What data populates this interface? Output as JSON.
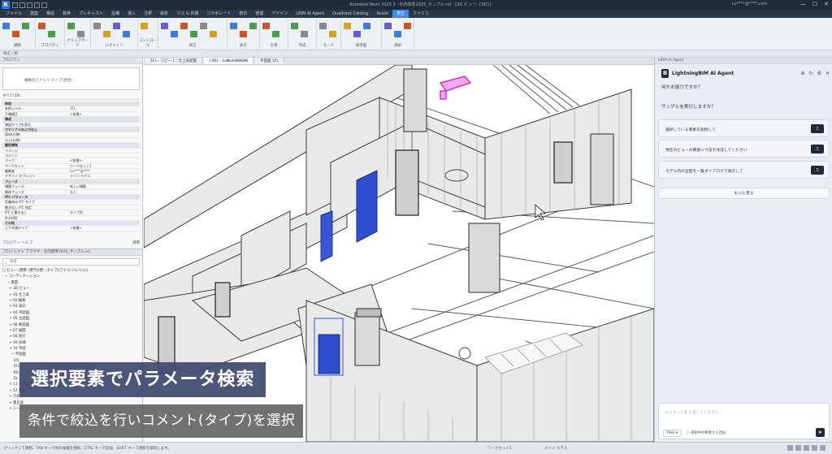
{
  "titlebar": {
    "app_icon": "R",
    "title": "Autodesk Revit 2025.3 - 社内標準2025_サンプル.rvt - [3D ビュー: {3D}]",
    "user": "Lu****@****.com",
    "window_controls": [
      "—",
      "☐",
      "✕"
    ]
  },
  "ribbon": {
    "tabs": [
      "ファイル",
      "建築",
      "構造",
      "鉄骨",
      "プレキャスト",
      "設備",
      "挿入",
      "注釈",
      "解析",
      "マス & 外構",
      "コラボレート",
      "表示",
      "管理",
      "アドイン",
      "LBIM AI Agent",
      "Quadrant Catalog",
      "Assist",
      "修正",
      "ファミリ"
    ],
    "active_tab": "修正",
    "groups": [
      "選択",
      "プロパティ",
      "クリップボード",
      "ジオメトリ",
      "コントロール",
      "修正",
      "表示",
      "計測",
      "作成",
      "モード",
      "基準面",
      "選択"
    ],
    "sub_bar": "修正 | 壁"
  },
  "properties": {
    "title": "プロパティ",
    "type_selector": "複数のファミリ タイプ(混合)",
    "filter": "すべて(26)",
    "rows": [
      {
        "k": "拘束",
        "v": "",
        "hdr": true
      },
      {
        "k": "参照レベル",
        "v": "1FL"
      },
      {
        "k": "下端補正",
        "v": "<各種>"
      },
      {
        "k": "構成",
        "v": "",
        "hdr": true
      },
      {
        "k": "端部タイプを表示",
        "v": ""
      },
      {
        "k": "マテリアルおよび仕上",
        "v": "",
        "hdr": true
      },
      {
        "k": "面材(仕様)",
        "v": ""
      },
      {
        "k": "仕上(仕様)",
        "v": ""
      },
      {
        "k": "識別情報",
        "v": "",
        "hdr": true
      },
      {
        "k": "イメージ",
        "v": ""
      },
      {
        "k": "コメント",
        "v": ""
      },
      {
        "k": "マーク",
        "v": "<各種>"
      },
      {
        "k": "ワークセット",
        "v": "ワークセット1"
      },
      {
        "k": "編集者",
        "v": "Lu****@****"
      },
      {
        "k": "デザイン オプション",
        "v": "メイン モデル"
      },
      {
        "k": "フェーズ",
        "v": "",
        "hdr": true
      },
      {
        "k": "構築フェーズ",
        "v": "新しい構築"
      },
      {
        "k": "解体フェーズ",
        "v": "なし"
      },
      {
        "k": "IFC パラメータ",
        "v": "",
        "hdr": true
      },
      {
        "k": "定義済み IFC タイプ",
        "v": ""
      },
      {
        "k": "書き出し IFC 指定",
        "v": ""
      },
      {
        "k": "IFC に書き出し",
        "v": "タイプ別"
      },
      {
        "k": "IfcGUID",
        "v": ""
      },
      {
        "k": "その他",
        "v": "",
        "hdr": true
      },
      {
        "k": "上下共通タイプ",
        "v": "<各種>"
      }
    ],
    "help_link": "プロパティ ヘルプ",
    "apply": "適用"
  },
  "browser": {
    "title": "プロジェクト ブラウザ - 社内標準2025_サンプル.rvt",
    "search_placeholder": "検索",
    "tree": [
      "□ ビュー (標準 (専門分野・タイプ)/ファミリ/レベル))",
      "  − コーディネーション",
      "    − 建築",
      "      + 3D ビュー",
      "      + 01 仕上表",
      "      + 02 概要",
      "      + 03 表記",
      "      + 04 平面図",
      "      + 05 立面図",
      "      + 06 断面図",
      "      + 07 展開",
      "      + 08 矩計",
      "      + 09 詳細",
      "      + 10 平面",
      "        − 平面図",
      "          1FL",
      "          2FL",
      "          RFL",
      "          GL",
      "      + 11 天井伏",
      "      + 12 建具",
      "      + 凡例",
      "      + 集計表",
      "      + シート"
    ]
  },
  "viewtabs": [
    "1FL - コピー 1 : 仕上表配置",
    "{3D} - LuNishi89G88",
    "平面図 1FL"
  ],
  "agent": {
    "panel_title": "LBIM AI Agent",
    "brand": "LightningBIM AI Agent",
    "logo": "B",
    "greeting": "何かお困りですか？",
    "prompt": "サンプルを実行しますか？",
    "suggestions": [
      "選択している要素を削除して",
      "現在のビューの要素に寸法を作成してください",
      "モデル内の全壁を一覧ダイアログで表示して"
    ],
    "run_icon": "play-icon",
    "more_label": "もっと見る",
    "composer_placeholder": "メッセージを入力してください...",
    "mode": "Plan",
    "checkbox_label": "選択中の要素から追加",
    "send_icon": "send-icon"
  },
  "statusbar": {
    "left": "クリックして選択、TAB キーで他の候補を選択、CTRL キーで追加、SHIFT キーで選択を解除します。",
    "workset": "ワークセット1",
    "model": "メイン モデル"
  },
  "captions": {
    "title": "選択要素でパラメータ検索",
    "subtitle": "条件で絞込を行いコメント(タイプ)を選択"
  },
  "colors": {
    "accent": "#3d8af0",
    "door_blue": "#2f4fd0",
    "selected_magenta": "#d231d2",
    "agent_button": "#1f2937"
  }
}
